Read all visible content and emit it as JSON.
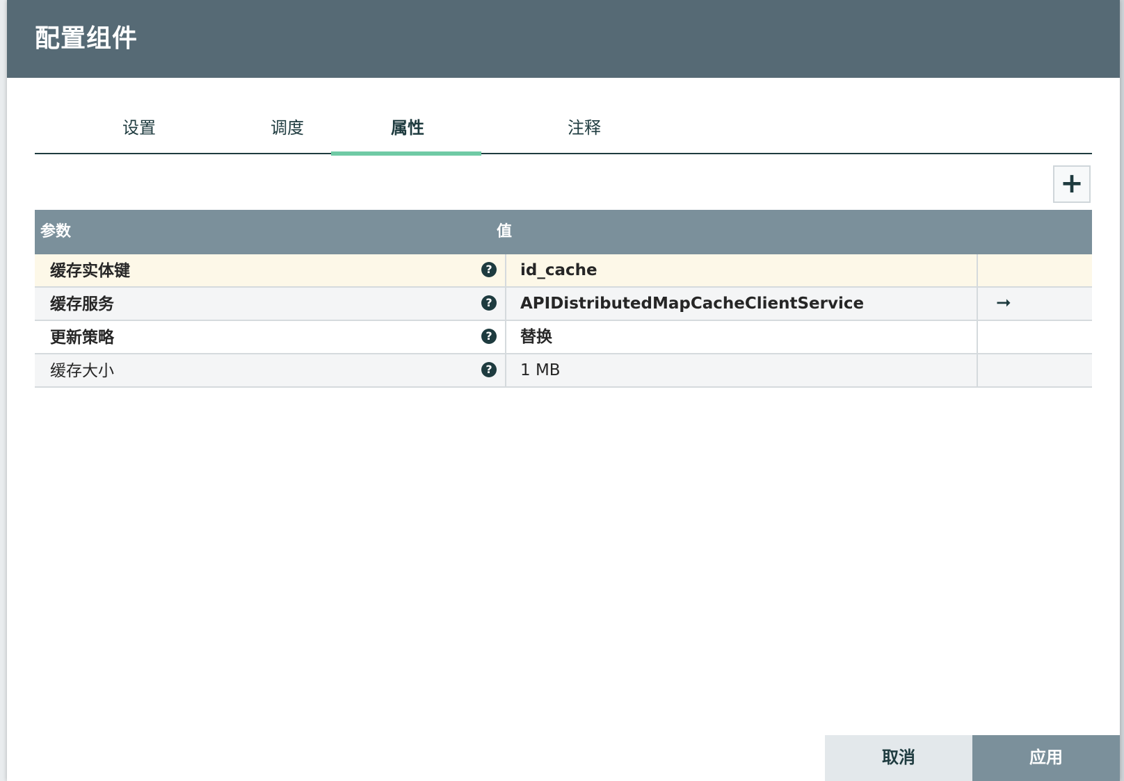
{
  "dialog": {
    "title": "配置组件"
  },
  "tabs": [
    {
      "label": "设置",
      "active": false
    },
    {
      "label": "调度",
      "active": false
    },
    {
      "label": "属性",
      "active": true
    },
    {
      "label": "注释",
      "active": false
    }
  ],
  "add_icon": "plus-icon",
  "table": {
    "headers": {
      "name": "参数",
      "value": "值"
    },
    "rows": [
      {
        "name": "缓存实体键",
        "value": "id_cache",
        "selected": true,
        "has_goto": false
      },
      {
        "name": "缓存服务",
        "value": "APIDistributedMapCacheClientService",
        "selected": false,
        "has_goto": true,
        "goto_symbol": "➞"
      },
      {
        "name": "更新策略",
        "value": "替换",
        "selected": false,
        "has_goto": false
      },
      {
        "name": "缓存大小",
        "value": "1 MB",
        "selected": false,
        "has_goto": false
      }
    ],
    "help_symbol": "?"
  },
  "footer": {
    "cancel_label": "取消",
    "apply_label": "应用"
  },
  "colors": {
    "header_bg": "#566a75",
    "table_header_bg": "#7b909b",
    "accent": "#6fcaa5",
    "dark_teal": "#1e3b3f",
    "selected_row": "#fdf8e8"
  }
}
